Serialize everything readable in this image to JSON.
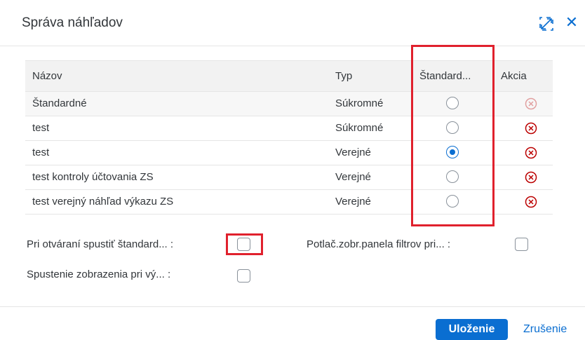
{
  "dialog": {
    "title": "Správa náhľadov",
    "expand_icon": "expand-icon",
    "close_icon": "close-icon",
    "close_glyph": "✕"
  },
  "table": {
    "columns": [
      "Názov",
      "Typ",
      "Štandard...",
      "Akcia"
    ],
    "rows": [
      {
        "name": "Štandardné",
        "type": "Súkromné",
        "standard": false,
        "delete_enabled": false
      },
      {
        "name": "test",
        "type": "Súkromné",
        "standard": false,
        "delete_enabled": true
      },
      {
        "name": "test",
        "type": "Verejné",
        "standard": true,
        "delete_enabled": true
      },
      {
        "name": "test kontroly účtovania ZS",
        "type": "Verejné",
        "standard": false,
        "delete_enabled": true
      },
      {
        "name": "test verejný náhľad výkazu ZS",
        "type": "Verejné",
        "standard": false,
        "delete_enabled": true
      }
    ]
  },
  "options": {
    "open_standard_label": "Pri otváraní spustiť štandard... :",
    "suppress_filter_label": "Potlač.zobr.panela filtrov pri... :",
    "run_display_label": "Spustenie zobrazenia pri vý... :",
    "open_standard_checked": false,
    "suppress_filter_checked": false,
    "run_display_checked": false
  },
  "footer": {
    "save_label": "Uloženie",
    "cancel_label": "Zrušenie"
  },
  "colors": {
    "accent": "#0a6ed1",
    "delete": "#bb0000",
    "highlight": "#e0212d"
  }
}
